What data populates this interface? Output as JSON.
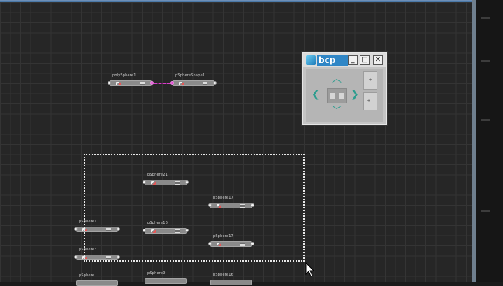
{
  "window": {
    "title": "bcp"
  },
  "window_buttons": {
    "minimize": "_",
    "maximize": "□",
    "close": "✕"
  },
  "nodes": [
    {
      "id": "n1",
      "label": "polySphere1"
    },
    {
      "id": "n2",
      "label": "pSphereShape1"
    },
    {
      "id": "n3",
      "label": "pSphere21"
    },
    {
      "id": "n4",
      "label": "pSphere17"
    },
    {
      "id": "n5",
      "label": "pSphere1"
    },
    {
      "id": "n6",
      "label": "pSphere16"
    },
    {
      "id": "n7",
      "label": "pSphere17"
    },
    {
      "id": "n8",
      "label": "pSphere3"
    },
    {
      "id": "n9",
      "label": "pSphere"
    },
    {
      "id": "n10",
      "label": "pSphere9"
    },
    {
      "id": "n11",
      "label": "pSphere16"
    }
  ],
  "controls": {
    "side_button_top": "+",
    "side_button_bottom": "+ -"
  },
  "icons": [
    "bcp-logo-icon",
    "arrow-up-icon",
    "arrow-down-icon",
    "arrow-left-icon",
    "arrow-right-icon",
    "mouse-cursor-icon"
  ],
  "colors": {
    "canvas": "#262626",
    "grid": "#343434",
    "connection": "#d63fc7",
    "arrow": "#2d9d8f",
    "title_bg": "#2f86c6"
  }
}
